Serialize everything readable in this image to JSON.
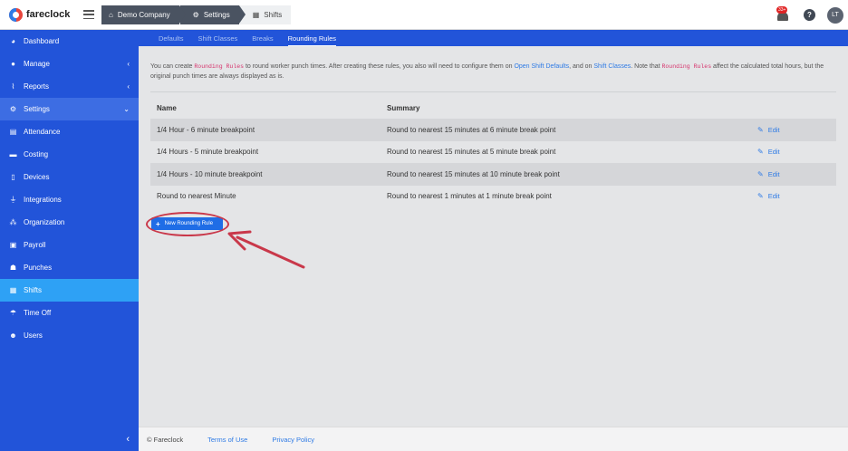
{
  "brand": {
    "name": "fareclock"
  },
  "breadcrumb": [
    {
      "label": "Demo Company",
      "icon": "home-icon"
    },
    {
      "label": "Settings",
      "icon": "gear-icon"
    },
    {
      "label": "Shifts",
      "icon": "calendar-icon"
    }
  ],
  "header": {
    "notifications_badge": "33+",
    "help": "?",
    "avatar_initials": "LT"
  },
  "sidebar": {
    "items": [
      {
        "label": "Dashboard",
        "icon": "dashboard-icon"
      },
      {
        "label": "Manage",
        "icon": "user-icon",
        "chevron": "‹"
      },
      {
        "label": "Reports",
        "icon": "chart-icon",
        "chevron": "‹"
      },
      {
        "label": "Settings",
        "icon": "gear-icon",
        "chevron": "⌄"
      },
      {
        "label": "Attendance",
        "icon": "attendance-icon"
      },
      {
        "label": "Costing",
        "icon": "costing-icon"
      },
      {
        "label": "Devices",
        "icon": "device-icon"
      },
      {
        "label": "Integrations",
        "icon": "plug-icon"
      },
      {
        "label": "Organization",
        "icon": "org-icon"
      },
      {
        "label": "Payroll",
        "icon": "payroll-icon"
      },
      {
        "label": "Punches",
        "icon": "punch-icon"
      },
      {
        "label": "Shifts",
        "icon": "calendar-icon"
      },
      {
        "label": "Time Off",
        "icon": "beach-icon"
      },
      {
        "label": "Users",
        "icon": "users-icon"
      }
    ],
    "collapse": "‹"
  },
  "tabs": [
    "Defaults",
    "Shift Classes",
    "Breaks",
    "Rounding Rules"
  ],
  "intro": {
    "t1": "You can create ",
    "code1": "Rounding Rules",
    "t2": " to round worker punch times. After creating these rules, you also will need to configure them on ",
    "link1": "Open Shift Defaults",
    "t3": ", and on ",
    "link2": "Shift Classes",
    "t4": ". Note that ",
    "code2": "Rounding Rules",
    "t5": " affect the calculated total hours, but the original punch times are always displayed as is."
  },
  "table": {
    "headers": {
      "name": "Name",
      "summary": "Summary"
    },
    "rows": [
      {
        "name": "1/4 Hour - 6 minute breakpoint",
        "summary": "Round to nearest 15 minutes at 6 minute break point",
        "edit": "Edit"
      },
      {
        "name": "1/4 Hours - 5 minute breakpoint",
        "summary": "Round to nearest 15 minutes at 5 minute break point",
        "edit": "Edit"
      },
      {
        "name": "1/4 Hours - 10 minute breakpoint",
        "summary": "Round to nearest 15 minutes at 10 minute break point",
        "edit": "Edit"
      },
      {
        "name": "Round to nearest Minute",
        "summary": "Round to nearest 1 minutes at 1 minute break point",
        "edit": "Edit"
      }
    ]
  },
  "new_button": {
    "label": "New Rounding Rule"
  },
  "footer": {
    "copyright": "© Fareclock",
    "terms": "Terms of Use",
    "privacy": "Privacy Policy"
  },
  "colors": {
    "sidebar": "#2254d9",
    "active": "#2ea1f5",
    "link": "#2f7be5",
    "annotation": "#c9384a"
  }
}
